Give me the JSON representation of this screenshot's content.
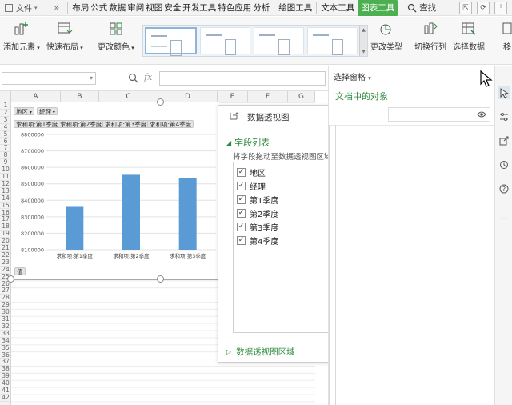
{
  "menu": {
    "file": "文件",
    "more": "»",
    "tabs": [
      "布局",
      "公式",
      "数据",
      "审阅",
      "视图",
      "安全",
      "开发工具",
      "特色应用",
      "分析"
    ],
    "chart_tabs": [
      "绘图工具",
      "文本工具"
    ],
    "active_tab": "图表工具",
    "search": "查找"
  },
  "ribbon": {
    "add_element": "添加元素",
    "quick_layout": "快速布局",
    "change_color": "更改颜色",
    "change_type": "更改类型",
    "switch_row_col": "切换行列",
    "select_data": "选择数据",
    "move": "移"
  },
  "formula_bar": {
    "namebox": "",
    "fx": "fx",
    "value": ""
  },
  "sheet": {
    "columns": [
      "A",
      "B",
      "C",
      "D",
      "E",
      "F",
      "G"
    ],
    "rows": [
      "1",
      "2",
      "3",
      "4",
      "5",
      "6",
      "7",
      "8",
      "9",
      "10",
      "11",
      "12",
      "13",
      "14",
      "15",
      "16",
      "17",
      "18",
      "19",
      "20",
      "21",
      "22",
      "23",
      "24",
      "25",
      "26",
      "27",
      "28",
      "29",
      "30",
      "31",
      "32",
      "33",
      "34",
      "35",
      "36",
      "37",
      "38",
      "39",
      "40",
      "41",
      "42"
    ]
  },
  "chart": {
    "filter_buttons": [
      "地区",
      "经理"
    ],
    "legend_buttons": [
      "求和项:第1季度",
      "求和项:第2季度",
      "求和项:第3季度",
      "求和项:第4季度"
    ],
    "value_button": "值"
  },
  "chart_data": {
    "type": "bar",
    "categories": [
      "求和项:第1季度",
      "求和项:第2季度",
      "求和项:第3季度"
    ],
    "values": [
      8365000,
      8555000,
      8535000
    ],
    "ylim": [
      8100000,
      8800000
    ],
    "yticks": [
      "8100000",
      "8200000",
      "8300000",
      "8400000",
      "8500000",
      "8600000",
      "8700000",
      "8800000"
    ],
    "grid": true,
    "bar_color": "#5b9bd5"
  },
  "pivot_panel": {
    "title": "数据透视图",
    "section_title": "字段列表",
    "hint": "将字段拖动至数据透视图区域",
    "fields": [
      {
        "label": "地区",
        "checked": true
      },
      {
        "label": "经理",
        "checked": true
      },
      {
        "label": "第1季度",
        "checked": true
      },
      {
        "label": "第2季度",
        "checked": true
      },
      {
        "label": "第3季度",
        "checked": true
      },
      {
        "label": "第4季度",
        "checked": true
      }
    ],
    "areas_title": "数据透视图区域"
  },
  "selection_pane": {
    "title": "选择窗格",
    "subtitle": "文档中的对象"
  },
  "colors": {
    "accent_green": "#4caf50",
    "link_green": "#2e8b3d",
    "bar_blue": "#5b9bd5"
  }
}
